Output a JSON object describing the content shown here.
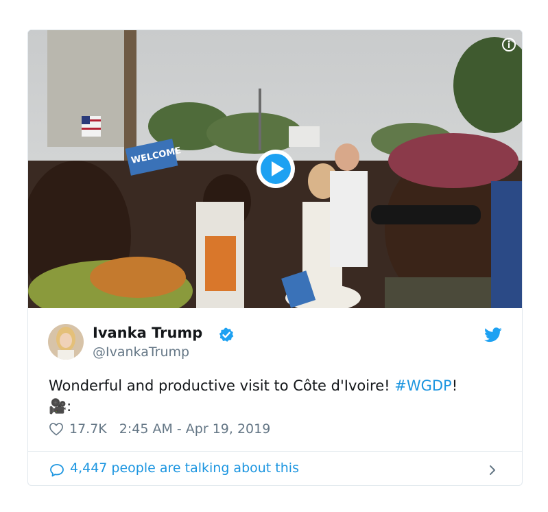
{
  "media": {
    "info_icon": "info-icon",
    "play_icon": "play-icon",
    "sign_text": "WELCOME"
  },
  "author": {
    "name": "Ivanka Trump",
    "handle": "@IvankaTrump",
    "verified_icon": "verified-badge-icon"
  },
  "tweet": {
    "text_before": "Wonderful and productive visit to Côte d'Ivoire! ",
    "hashtag": "#WGDP",
    "text_after": "!",
    "line2": "🎥:"
  },
  "meta": {
    "likes": "17.7K",
    "timestamp": "2:45 AM - Apr 19, 2019"
  },
  "footer": {
    "talking": "4,447 people are talking about this"
  },
  "colors": {
    "accent": "#1b95e0",
    "secondary_text": "#657786",
    "border": "#e1e8ed",
    "verified": "#1da1f2"
  }
}
